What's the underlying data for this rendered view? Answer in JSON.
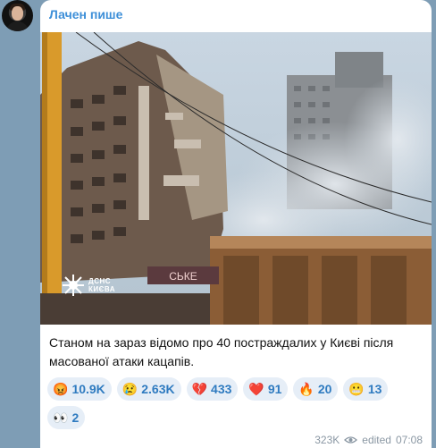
{
  "channel": {
    "author": "Лачен пише"
  },
  "post": {
    "image_watermark": {
      "line1": "ДСНС",
      "line2": "КИЄВА"
    },
    "shop_sign": "СЬКЕ",
    "caption": "Станом на зараз відомо про 40 постраждалих у Києві після масованої атаки кацапів."
  },
  "reactions": [
    {
      "emoji": "😡",
      "icon": "angry-face-icon",
      "count": "10.9K"
    },
    {
      "emoji": "😢",
      "icon": "crying-face-icon",
      "count": "2.63K"
    },
    {
      "emoji": "💔",
      "icon": "broken-heart-icon",
      "count": "433"
    },
    {
      "emoji": "❤️",
      "icon": "red-heart-icon",
      "count": "91"
    },
    {
      "emoji": "🔥",
      "icon": "fire-icon",
      "count": "20"
    },
    {
      "emoji": "😬",
      "icon": "grimacing-face-icon",
      "count": "13"
    },
    {
      "emoji": "👀",
      "icon": "eyes-icon",
      "count": "2"
    }
  ],
  "footer": {
    "views": "323K",
    "edited_label": "edited",
    "time": "07:08"
  },
  "colors": {
    "background": "#7e9db5",
    "author": "#3d8fd8",
    "reaction_bg": "#e6eef7",
    "reaction_text": "#2f7bc0"
  }
}
